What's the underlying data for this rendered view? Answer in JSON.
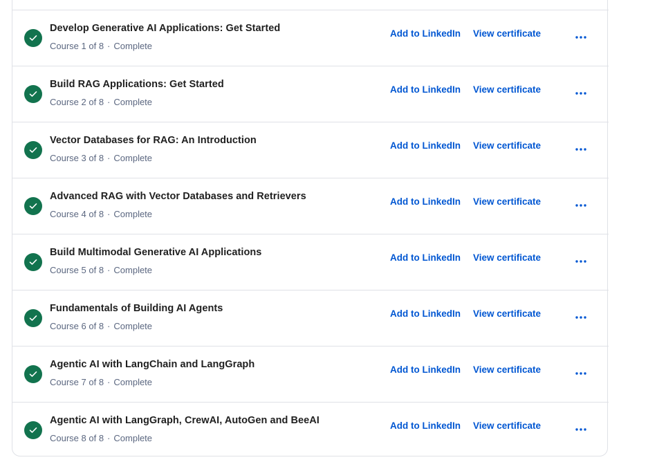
{
  "courses": [
    {
      "title": "Develop Generative AI Applications: Get Started",
      "course_label": "Course 1 of 8",
      "status": "Complete"
    },
    {
      "title": "Build RAG Applications: Get Started",
      "course_label": "Course 2 of 8",
      "status": "Complete"
    },
    {
      "title": "Vector Databases for RAG: An Introduction",
      "course_label": "Course 3 of 8",
      "status": "Complete"
    },
    {
      "title": "Advanced RAG with Vector Databases and Retrievers",
      "course_label": "Course 4 of 8",
      "status": "Complete"
    },
    {
      "title": "Build Multimodal Generative AI Applications",
      "course_label": "Course 5 of 8",
      "status": "Complete"
    },
    {
      "title": "Fundamentals of Building AI Agents",
      "course_label": "Course 6 of 8",
      "status": "Complete"
    },
    {
      "title": "Agentic AI with LangChain and LangGraph",
      "course_label": "Course 7 of 8",
      "status": "Complete"
    },
    {
      "title": "Agentic AI with LangGraph, CrewAI, AutoGen and BeeAI",
      "course_label": "Course 8 of 8",
      "status": "Complete"
    }
  ],
  "actions": {
    "linkedin_label": "Add to LinkedIn",
    "certificate_label": "View certificate",
    "more_icon": "more-horizontal-icon"
  },
  "separator": "·",
  "colors": {
    "check_green": "#12734e",
    "link_blue": "#0056d2",
    "title_text": "#1f1f1f",
    "meta_text": "#5b6780",
    "border": "#dfe1e6"
  }
}
